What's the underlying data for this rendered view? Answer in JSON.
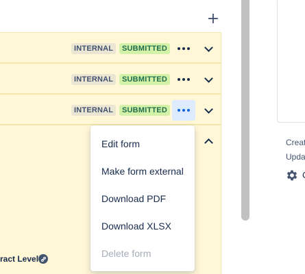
{
  "toolbar": {
    "add_label": "+"
  },
  "forms": [
    {
      "visibility": "INTERNAL",
      "status": "SUBMITTED"
    },
    {
      "visibility": "INTERNAL",
      "status": "SUBMITTED"
    },
    {
      "visibility": "INTERNAL",
      "status": "SUBMITTED"
    }
  ],
  "expanded_form": {
    "field_label": "ract Level"
  },
  "menu": {
    "items": [
      {
        "label": "Edit form",
        "enabled": true
      },
      {
        "label": "Make form external",
        "enabled": true
      },
      {
        "label": "Download PDF",
        "enabled": true
      },
      {
        "label": "Download XLSX",
        "enabled": true
      },
      {
        "label": "Delete form",
        "enabled": false
      }
    ]
  },
  "side_panel": {
    "created_prefix": "Creat",
    "updated_prefix": "Upda",
    "settings_prefix": "C"
  },
  "colors": {
    "row_background": "#fff7d6",
    "internal_lozenge": "#ebe6d4",
    "submitted_lozenge": "#d3f1a7",
    "active_button": "#deebff",
    "active_dots": "#0c66e4"
  },
  "icons": [
    "plus-icon",
    "more-icon",
    "chevron-down-icon",
    "chevron-up-icon",
    "link-icon",
    "gear-icon"
  ]
}
